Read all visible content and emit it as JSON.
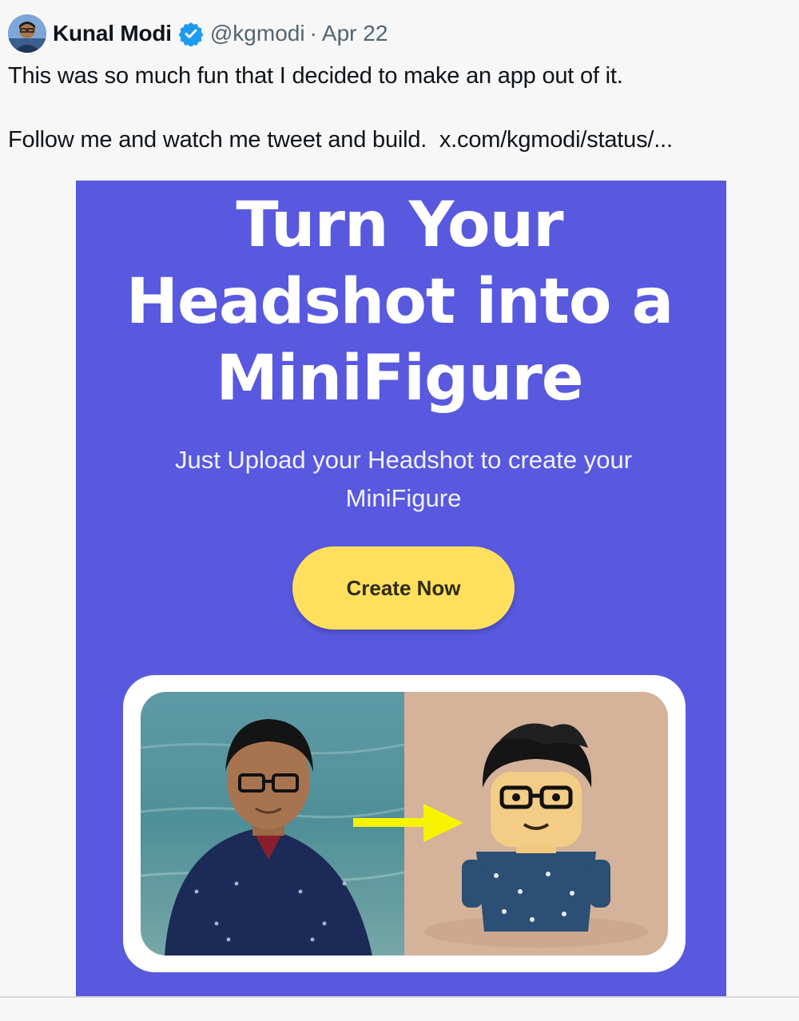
{
  "author": {
    "name": "Kunal Modi",
    "handle": "@kgmodi",
    "separator": "·",
    "date": "Apr 22",
    "verified": true
  },
  "tweet": {
    "line1": "This was so much fun that I decided to make an app out of it.",
    "line2": "Follow me and watch me tweet and build.",
    "link": "x.com/kgmodi/status/..."
  },
  "promo": {
    "title_lines": [
      "Turn Your",
      "Headshot into a",
      "MiniFigure"
    ],
    "subtitle": "Just Upload your Headshot to create your MiniFigure",
    "cta_label": "Create Now"
  },
  "colors": {
    "promo_background": "#5859df",
    "cta_background": "#ffe05d",
    "verified_badge": "#1d9bf0",
    "arrow": "#f8f400"
  },
  "icons": {
    "verified": "verified-badge-icon",
    "arrow": "arrow-right-icon"
  }
}
